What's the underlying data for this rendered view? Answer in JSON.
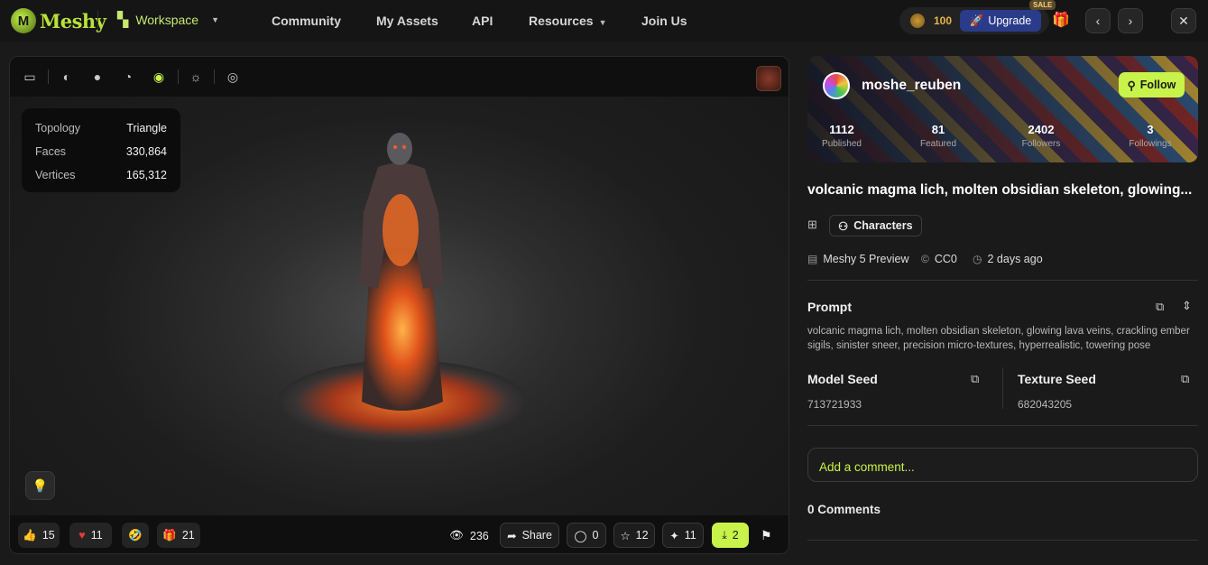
{
  "nav": {
    "logo_mark": "M",
    "logo_text": "Meshy",
    "workspace_label": "Workspace",
    "items": [
      "Community",
      "My Assets",
      "API",
      "Resources",
      "Join Us"
    ],
    "credits": "100",
    "upgrade_label": "Upgrade",
    "sale_badge": "SALE"
  },
  "viewer": {
    "stats": [
      {
        "label": "Topology",
        "value": "Triangle"
      },
      {
        "label": "Faces",
        "value": "330,864"
      },
      {
        "label": "Vertices",
        "value": "165,312"
      }
    ],
    "reactions": {
      "likes": "15",
      "hearts": "11",
      "gifts": "21"
    },
    "views": "236",
    "share_label": "Share",
    "comments_count": "0",
    "stars": "12",
    "remixes": "11",
    "downloads": "2"
  },
  "author": {
    "username": "moshe_reuben",
    "follow_label": "Follow",
    "stats": [
      {
        "value": "1112",
        "label": "Published"
      },
      {
        "value": "81",
        "label": "Featured"
      },
      {
        "value": "2402",
        "label": "Followers"
      },
      {
        "value": "3",
        "label": "Followings"
      }
    ]
  },
  "model": {
    "title": "volcanic magma lich, molten obsidian skeleton, glowing...",
    "category": "Characters",
    "engine": "Meshy 5 Preview",
    "license": "CC0",
    "time_ago": "2 days ago"
  },
  "prompt": {
    "heading": "Prompt",
    "text": "volcanic magma lich, molten obsidian skeleton, glowing lava veins, crackling ember sigils, sinister sneer, precision micro-textures, hyperrealistic, towering pose"
  },
  "seeds": {
    "model_heading": "Model Seed",
    "model_value": "713721933",
    "texture_heading": "Texture Seed",
    "texture_value": "682043205"
  },
  "comments": {
    "placeholder": "Add a comment...",
    "count_label": "0 Comments"
  },
  "colors": {
    "accent": "#c8f34a",
    "upgrade": "#2a3b8a"
  }
}
